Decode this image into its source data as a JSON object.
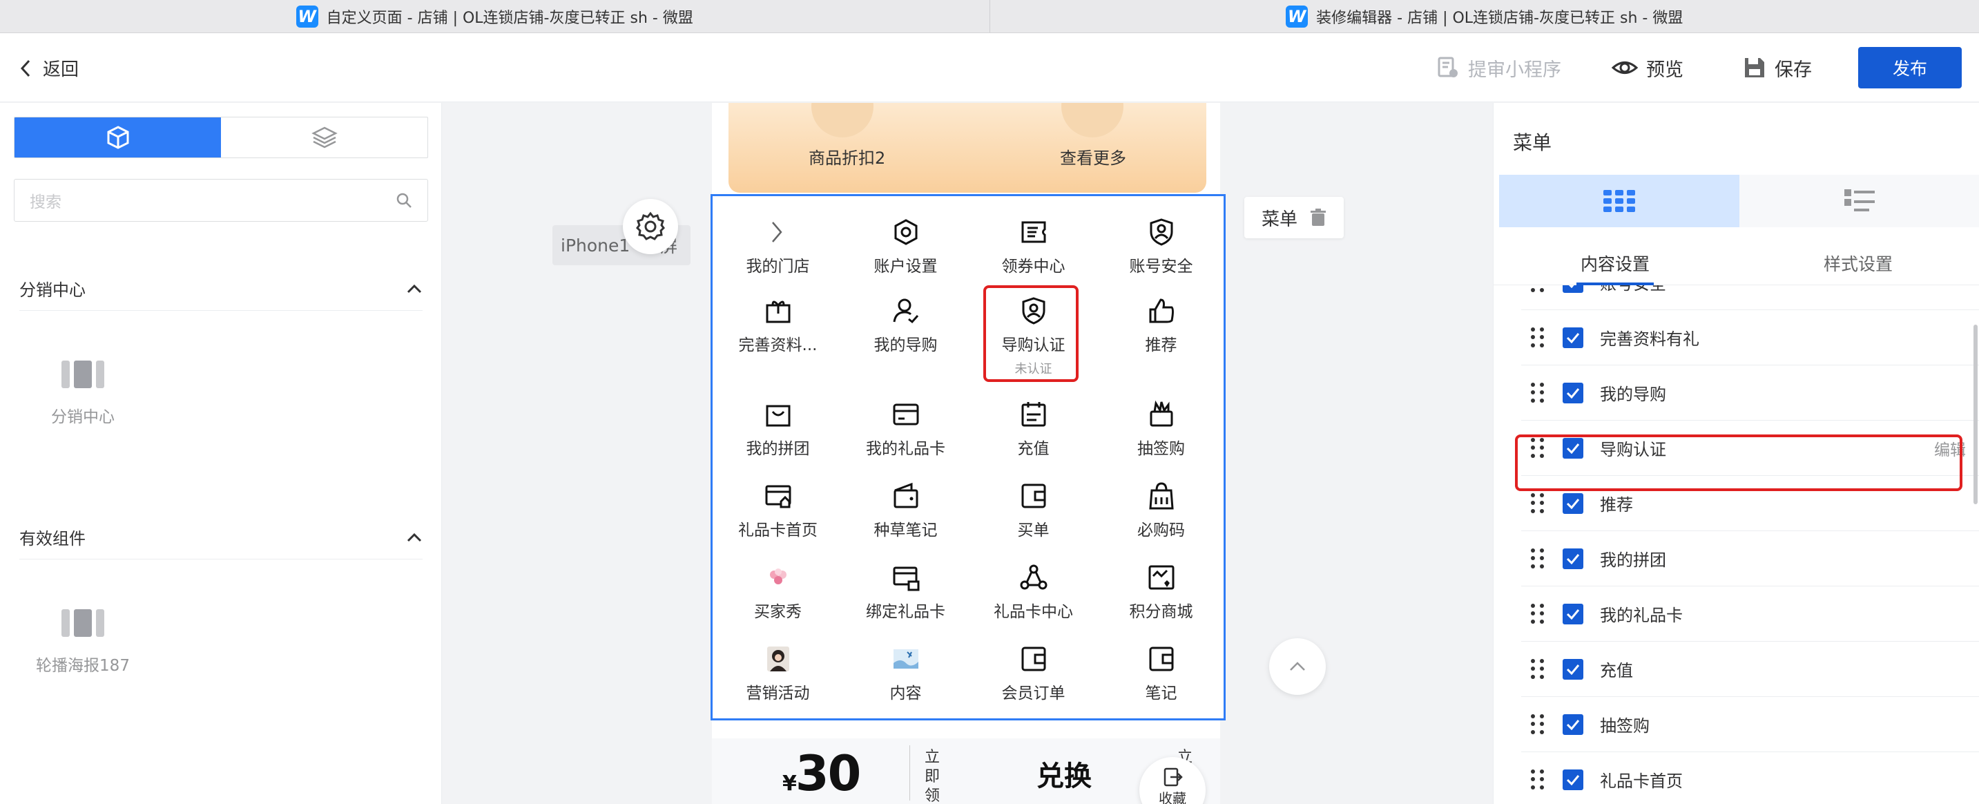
{
  "window_tabs": [
    {
      "logo": "W",
      "title": "自定义页面 - 店铺 | OL连锁店铺-灰度已转正 sh - 微盟"
    },
    {
      "logo": "W",
      "title": "装修编辑器 - 店铺 | OL连锁店铺-灰度已转正 sh - 微盟"
    }
  ],
  "header": {
    "back_label": "返回",
    "submit_label": "提审小程序",
    "preview_label": "预览",
    "save_label": "保存",
    "publish_label": "发布"
  },
  "left_panel": {
    "search_placeholder": "搜索",
    "groups": [
      {
        "title": "分销中心",
        "components": [
          "分销中心"
        ]
      },
      {
        "title": "有效组件",
        "components": [
          "轮播海报187"
        ]
      }
    ]
  },
  "canvas": {
    "iphone_label": "iPhone1",
    "iphone_label_tail": "屏",
    "selected_tag": "菜单",
    "top_items": [
      "商品折扣2",
      "查看更多"
    ],
    "menu_items": [
      {
        "label": "我的门店",
        "icon": "chevron-right-icon"
      },
      {
        "label": "账户设置",
        "icon": "hexagon-gear-icon"
      },
      {
        "label": "领券中心",
        "icon": "coupon-icon"
      },
      {
        "label": "账号安全",
        "icon": "user-shield-icon"
      },
      {
        "label": "完善资料...",
        "icon": "gift-box-icon"
      },
      {
        "label": "我的导购",
        "icon": "user-check-icon"
      },
      {
        "label": "导购认证",
        "icon": "shield-user-icon",
        "sub": "未认证"
      },
      {
        "label": "推荐",
        "icon": "thumbs-up-icon"
      },
      {
        "label": "我的拼团",
        "icon": "bag-icon"
      },
      {
        "label": "我的礼品卡",
        "icon": "card-icon"
      },
      {
        "label": "充值",
        "icon": "calendar-icon"
      },
      {
        "label": "抽签购",
        "icon": "lottery-icon"
      },
      {
        "label": "礼品卡首页",
        "icon": "card-home-icon"
      },
      {
        "label": "种草笔记",
        "icon": "wallet-icon"
      },
      {
        "label": "买单",
        "icon": "bill-icon"
      },
      {
        "label": "必购码",
        "icon": "shopping-bag-icon"
      },
      {
        "label": "买家秀",
        "icon": "flower-image-icon"
      },
      {
        "label": "绑定礼品卡",
        "icon": "card-lock-icon"
      },
      {
        "label": "礼品卡中心",
        "icon": "network-icon"
      },
      {
        "label": "积分商城",
        "icon": "points-store-icon"
      },
      {
        "label": "营销活动",
        "icon": "avatar-photo-icon"
      },
      {
        "label": "内容",
        "icon": "content-photo-icon"
      },
      {
        "label": "会员订单",
        "icon": "bill-icon"
      },
      {
        "label": "笔记",
        "icon": "bill-icon"
      }
    ],
    "bottom": {
      "currency": "¥",
      "price": "30",
      "vertical_1": "立即领",
      "exchange": "兑换",
      "vertical_2": "立",
      "favorite_label": "收藏"
    }
  },
  "right_panel": {
    "title": "菜单",
    "tabs": [
      "内容设置",
      "样式设置"
    ],
    "active_tab": "内容设置",
    "items": [
      {
        "label": "账号安全",
        "checked": true
      },
      {
        "label": "完善资料有礼",
        "checked": true
      },
      {
        "label": "我的导购",
        "checked": true
      },
      {
        "label": "导购认证",
        "checked": true,
        "action": "编辑"
      },
      {
        "label": "推荐",
        "checked": true
      },
      {
        "label": "我的拼团",
        "checked": true
      },
      {
        "label": "我的礼品卡",
        "checked": true
      },
      {
        "label": "充值",
        "checked": true
      },
      {
        "label": "抽签购",
        "checked": true
      },
      {
        "label": "礼品卡首页",
        "checked": true
      }
    ]
  },
  "colors": {
    "accent": "#155bd4",
    "highlight": "#e02020",
    "selected_border": "#2f7cf6"
  }
}
